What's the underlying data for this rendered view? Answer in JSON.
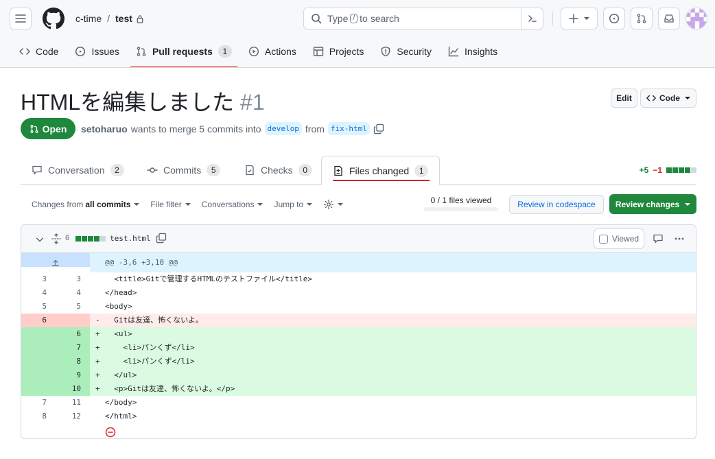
{
  "header": {
    "owner": "c-time",
    "separator": "/",
    "repo": "test",
    "search_prefix": "Type",
    "search_key": "/",
    "search_suffix": "to search"
  },
  "repo_nav": [
    {
      "label": "Code",
      "icon": "code-icon"
    },
    {
      "label": "Issues",
      "icon": "issue-icon"
    },
    {
      "label": "Pull requests",
      "icon": "pull-request-icon",
      "count": "1",
      "active": true
    },
    {
      "label": "Actions",
      "icon": "play-icon"
    },
    {
      "label": "Projects",
      "icon": "table-icon"
    },
    {
      "label": "Security",
      "icon": "shield-icon"
    },
    {
      "label": "Insights",
      "icon": "graph-icon"
    }
  ],
  "pr": {
    "title": "HTMLを編集しました",
    "number": "#1",
    "edit_label": "Edit",
    "code_label": "Code",
    "state": "Open",
    "author": "setoharuo",
    "merge_text": "wants to merge 5 commits into",
    "base_branch": "develop",
    "from_text": "from",
    "head_branch": "fix-html"
  },
  "tabs": [
    {
      "label": "Conversation",
      "count": "2"
    },
    {
      "label": "Commits",
      "count": "5"
    },
    {
      "label": "Checks",
      "count": "0"
    },
    {
      "label": "Files changed",
      "count": "1",
      "active": true
    }
  ],
  "diffstat": {
    "additions": "+5",
    "deletions": "−1"
  },
  "toolbar": {
    "changes_from_prefix": "Changes from",
    "changes_from_value": "all commits",
    "file_filter": "File filter",
    "conversations": "Conversations",
    "jump_to": "Jump to",
    "files_viewed": "0 / 1 files viewed",
    "review_codespace": "Review in codespace",
    "review_changes": "Review changes"
  },
  "file": {
    "changes": "6",
    "name": "test.html",
    "viewed_label": "Viewed",
    "hunk_header": "@@ -3,6 +3,10 @@"
  },
  "diff_lines": [
    {
      "type": "ctx",
      "old": "3",
      "new": "3",
      "marker": "",
      "code": "  <title>Gitで管理するHTMLのテストファイル</title>"
    },
    {
      "type": "ctx",
      "old": "4",
      "new": "4",
      "marker": "",
      "code": "</head>"
    },
    {
      "type": "ctx",
      "old": "5",
      "new": "5",
      "marker": "",
      "code": "<body>"
    },
    {
      "type": "del",
      "old": "6",
      "new": "",
      "marker": "-",
      "code": "  Gitは友達、怖くないよ。"
    },
    {
      "type": "add",
      "old": "",
      "new": "6",
      "marker": "+",
      "code": "  <ul>"
    },
    {
      "type": "add",
      "old": "",
      "new": "7",
      "marker": "+",
      "code": "    <li>パンくず</li>"
    },
    {
      "type": "add",
      "old": "",
      "new": "8",
      "marker": "+",
      "code": "    <li>パンくず</li>"
    },
    {
      "type": "add",
      "old": "",
      "new": "9",
      "marker": "+",
      "code": "  </ul>"
    },
    {
      "type": "add",
      "old": "",
      "new": "10",
      "marker": "+",
      "code": "  <p>Gitは友達、怖くないよ。</p>"
    },
    {
      "type": "ctx",
      "old": "7",
      "new": "11",
      "marker": "",
      "code": "</body>"
    },
    {
      "type": "ctx",
      "old": "8",
      "new": "12",
      "marker": "",
      "code": "</html>"
    }
  ],
  "colors": {
    "accent_green": "#1f883d",
    "link_blue": "#0969da",
    "tab_underline": "#d1242f",
    "nav_underline": "#fd8c73"
  }
}
